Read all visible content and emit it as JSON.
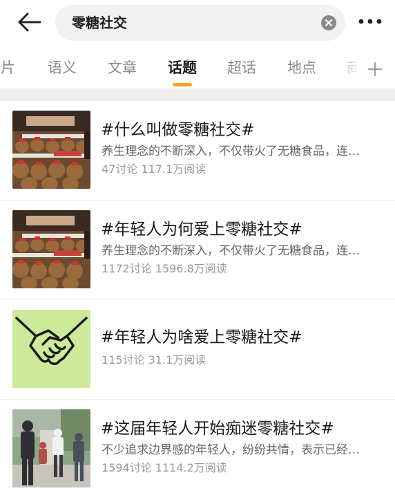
{
  "search": {
    "query": "零糖社交"
  },
  "icons": {
    "back": "arrow-left-icon",
    "clear": "close-circle-icon",
    "more": "more-horizontal-icon",
    "add": "plus-icon"
  },
  "tabs": [
    {
      "label": "图片",
      "active": false
    },
    {
      "label": "语义",
      "active": false
    },
    {
      "label": "文章",
      "active": false
    },
    {
      "label": "话题",
      "active": true
    },
    {
      "label": "超话",
      "active": false
    },
    {
      "label": "地点",
      "active": false
    },
    {
      "label": "商品",
      "active": false
    }
  ],
  "colors": {
    "accent": "#f5a623",
    "tab_inactive": "#8a8a8a",
    "band": "#efefef"
  },
  "topics": [
    {
      "title": "#什么叫做零糖社交#",
      "desc": "养生理念的不断深入，不仅带火了无糖食品，连…",
      "stats": "47讨论 117.1万阅读",
      "thumb": "capybara-plush-display"
    },
    {
      "title": "#年轻人为何爱上零糖社交#",
      "desc": "养生理念的不断深入，不仅带火了无糖食品，连…",
      "stats": "1172讨论 1596.8万阅读",
      "thumb": "capybara-plush-display"
    },
    {
      "title": "#年轻人为啥爱上零糖社交#",
      "desc": "",
      "stats": "115讨论 31.1万阅读",
      "thumb": "handshake-illustration"
    },
    {
      "title": "#这届年轻人开始痴迷零糖社交#",
      "desc": "不少追求边界感的年轻人，纷纷共情，表示已经…",
      "stats": "1594讨论 1114.2万阅读",
      "thumb": "people-outdoor-photo"
    }
  ]
}
